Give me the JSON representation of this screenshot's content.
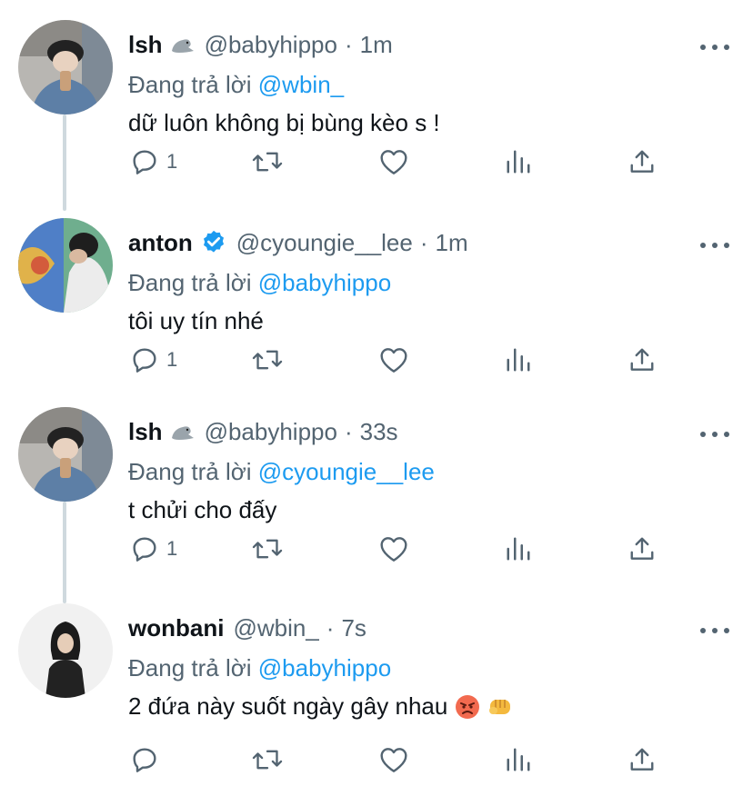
{
  "colors": {
    "text": "#0f1419",
    "secondary": "#536471",
    "link": "#1d9bf0",
    "thread_line": "#cfd9de",
    "verified": "#1d9bf0"
  },
  "tweets": [
    {
      "name": "lsh",
      "name_emoji": "seal-emoji",
      "verified": false,
      "handle": "@babyhippo",
      "dot": "·",
      "time": "1m",
      "reply_prefix": "Đang trả lời ",
      "reply_to": "@wbin_",
      "text": "dữ luôn không bị bùng kèo s !",
      "reply_count": "1"
    },
    {
      "name": "anton",
      "verified": true,
      "handle": "@cyoungie__lee",
      "dot": "·",
      "time": "1m",
      "reply_prefix": "Đang trả lời ",
      "reply_to": "@babyhippo",
      "text": "tôi uy tín nhé",
      "reply_count": "1"
    },
    {
      "name": "lsh",
      "name_emoji": "seal-emoji",
      "verified": false,
      "handle": "@babyhippo",
      "dot": "·",
      "time": "33s",
      "reply_prefix": "Đang trả lời ",
      "reply_to": "@cyoungie__lee",
      "text": "t chửi cho đấy",
      "reply_count": "1"
    },
    {
      "name": "wonbani",
      "verified": false,
      "handle": "@wbin_",
      "dot": "·",
      "time": "7s",
      "reply_prefix": "Đang trả lời ",
      "reply_to": "@babyhippo",
      "text": "2 đứa này suốt ngày gây nhau",
      "text_emojis": [
        "angry-face-emoji",
        "fist-emoji"
      ],
      "reply_count": ""
    }
  ],
  "icons": {
    "reply": "reply-icon",
    "retweet": "retweet-icon",
    "like": "like-icon",
    "analytics": "analytics-icon",
    "share": "share-icon",
    "more": "more-icon",
    "verified": "verified-badge-icon"
  }
}
